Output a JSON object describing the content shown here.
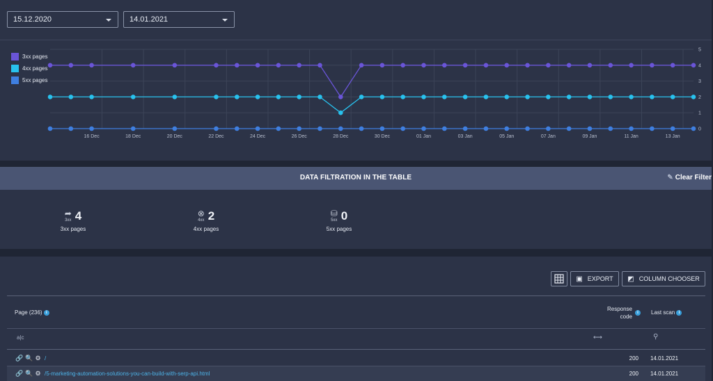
{
  "dates": {
    "from": "15.12.2020",
    "to": "14.01.2021"
  },
  "legend": [
    {
      "label": "3xx pages",
      "color": "#6a55d8"
    },
    {
      "label": "4xx pages",
      "color": "#28c2ee"
    },
    {
      "label": "5xx pages",
      "color": "#3f7fe0"
    }
  ],
  "chart_data": {
    "type": "line",
    "x": [
      "14 Dec",
      "15 Dec",
      "16 Dec",
      "17 Dec",
      "18 Dec",
      "19 Dec",
      "20 Dec",
      "21 Dec",
      "22 Dec",
      "23 Dec",
      "24 Dec",
      "25 Dec",
      "26 Dec",
      "27 Dec",
      "28 Dec",
      "29 Dec",
      "30 Dec",
      "31 Dec",
      "01 Jan",
      "02 Jan",
      "03 Jan",
      "04 Jan",
      "05 Jan",
      "06 Jan",
      "07 Jan",
      "08 Jan",
      "09 Jan",
      "10 Jan",
      "11 Jan",
      "12 Jan",
      "13 Jan",
      "14 Jan"
    ],
    "x_points": [
      "14 Dec",
      "15 Dec",
      "16 Dec",
      "18 Dec",
      "20 Dec",
      "22 Dec",
      "23 Dec",
      "24 Dec",
      "25 Dec",
      "26 Dec",
      "27 Dec",
      "28 Dec",
      "29 Dec",
      "30 Dec",
      "31 Dec",
      "01 Jan",
      "02 Jan",
      "03 Jan",
      "04 Jan",
      "05 Jan",
      "06 Jan",
      "07 Jan",
      "08 Jan",
      "09 Jan",
      "10 Jan",
      "11 Jan",
      "12 Jan",
      "13 Jan",
      "14 Jan"
    ],
    "x_ticks": [
      "16 Dec",
      "18 Dec",
      "20 Dec",
      "22 Dec",
      "24 Dec",
      "26 Dec",
      "28 Dec",
      "30 Dec",
      "01 Jan",
      "03 Jan",
      "05 Jan",
      "07 Jan",
      "09 Jan",
      "11 Jan",
      "13 Jan"
    ],
    "series": [
      {
        "name": "3xx pages",
        "color": "#6a55d8",
        "values": [
          4,
          4,
          4,
          4,
          4,
          4,
          4,
          4,
          4,
          4,
          4,
          2,
          4,
          4,
          4,
          4,
          4,
          4,
          4,
          4,
          4,
          4,
          4,
          4,
          4,
          4,
          4,
          4,
          4
        ]
      },
      {
        "name": "4xx pages",
        "color": "#28c2ee",
        "values": [
          2,
          2,
          2,
          2,
          2,
          2,
          2,
          2,
          2,
          2,
          2,
          1,
          2,
          2,
          2,
          2,
          2,
          2,
          2,
          2,
          2,
          2,
          2,
          2,
          2,
          2,
          2,
          2,
          2
        ]
      },
      {
        "name": "5xx pages",
        "color": "#3f7fe0",
        "values": [
          0,
          0,
          0,
          0,
          0,
          0,
          0,
          0,
          0,
          0,
          0,
          0,
          0,
          0,
          0,
          0,
          0,
          0,
          0,
          0,
          0,
          0,
          0,
          0,
          0,
          0,
          0,
          0,
          0
        ]
      }
    ],
    "y_ticks": [
      0,
      1,
      2,
      3,
      4,
      5
    ],
    "ylim": [
      0,
      5
    ],
    "grid": true,
    "legend_position": "top-left"
  },
  "filter": {
    "title": "DATA FILTRATION IN THE TABLE",
    "clear_label": "Clear Filter",
    "stats": [
      {
        "icon": "share-arrow-icon",
        "sub": "3xx",
        "count": "4",
        "label": "3xx pages"
      },
      {
        "icon": "x-circle-icon",
        "sub": "4xx",
        "count": "2",
        "label": "4xx pages"
      },
      {
        "icon": "database-icon",
        "sub": "5xx",
        "count": "0",
        "label": "5xx pages"
      }
    ]
  },
  "toolbar": {
    "export_label": "EXPORT",
    "column_chooser_label": "COLUMN CHOOSER"
  },
  "table": {
    "columns": {
      "page": "Page (236)",
      "response_line1": "Response",
      "response_line2": "code",
      "last_scan": "Last scan"
    },
    "filter_row": {
      "page_icon": "a|c"
    },
    "rows": [
      {
        "page": "/",
        "code": "200",
        "date": "14.01.2021"
      },
      {
        "page": "/5-marketing-automation-solutions-you-can-build-with-serp-api.html",
        "code": "200",
        "date": "14.01.2021"
      }
    ]
  }
}
